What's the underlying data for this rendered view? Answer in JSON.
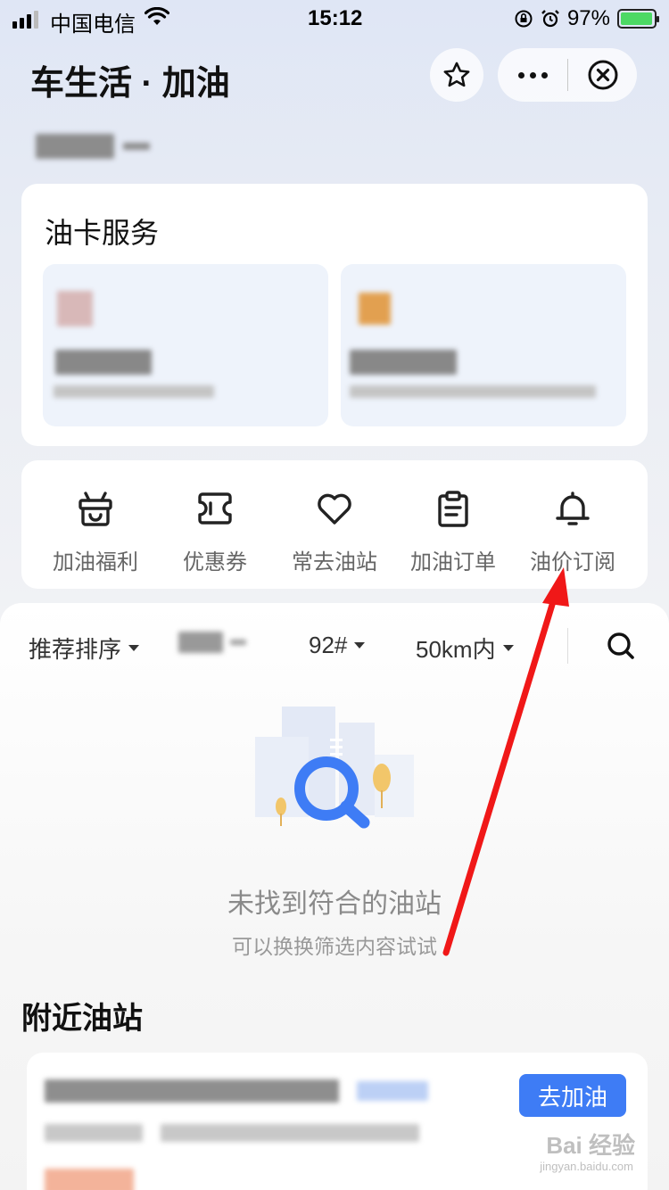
{
  "status_bar": {
    "carrier": "中国电信",
    "time": "15:12",
    "battery": "97%",
    "battery_level": 0.97
  },
  "header": {
    "title": "车生活 · 加油",
    "favorite_icon": "star-icon",
    "more_icon": "more-dots-icon",
    "close_icon": "close-circle-icon"
  },
  "oil_card": {
    "title": "油卡服务"
  },
  "quick_entries": [
    {
      "label": "加油福利",
      "icon": "gift-icon"
    },
    {
      "label": "优惠券",
      "icon": "coupon-icon"
    },
    {
      "label": "常去油站",
      "icon": "heart-icon"
    },
    {
      "label": "加油订单",
      "icon": "clipboard-icon"
    },
    {
      "label": "油价订阅",
      "icon": "bell-icon"
    }
  ],
  "filters": {
    "sort": "推荐排序",
    "fuel": "92#",
    "distance": "50km内",
    "search_icon": "search-icon"
  },
  "empty_state": {
    "title": "未找到符合的油站",
    "subtitle": "可以换换筛选内容试试"
  },
  "nearby": {
    "title": "附近油站",
    "go_button": "去加油"
  },
  "watermark": {
    "text": "Bai 经验",
    "sub": "jingyan.baidu.com"
  },
  "colors": {
    "accent": "#3e7cf5",
    "annotation": "#f01818",
    "tile_bg": "#eef3fb"
  }
}
